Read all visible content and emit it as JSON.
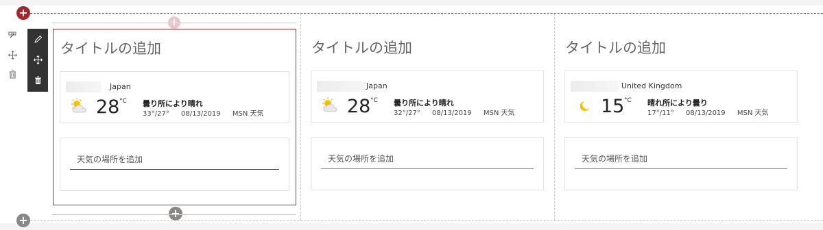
{
  "section": {
    "add_label": "+",
    "tools": {
      "edit_icon": "edit-section-icon",
      "move_icon": "move-icon",
      "delete_icon": "delete-icon"
    }
  },
  "toolbar": {
    "edit_icon": "pencil-icon",
    "move_icon": "move-icon",
    "delete_icon": "trash-icon"
  },
  "webparts": [
    {
      "title": "タイトルの追加",
      "country": "Japan",
      "temperature": "28",
      "unit": "°C",
      "condition": "曇り所により晴れ",
      "highlow": "33°/27°",
      "date": "08/13/2019",
      "source": "MSN 天気",
      "weather_icon": "partly-sunny-icon",
      "add_placeholder": "天気の場所を追加"
    },
    {
      "title": "タイトルの追加",
      "country": "Japan",
      "temperature": "28",
      "unit": "°C",
      "condition": "曇り所により晴れ",
      "highlow": "32°/27°",
      "date": "08/13/2019",
      "source": "MSN 天気",
      "weather_icon": "partly-sunny-icon",
      "add_placeholder": "天気の場所を追加"
    },
    {
      "title": "タイトルの追加",
      "country": "United Kingdom",
      "temperature": "15",
      "unit": "°C",
      "condition": "晴れ所により曇り",
      "highlow": "17°/11°",
      "date": "08/13/2019",
      "source": "MSN 天気",
      "weather_icon": "moon-icon",
      "add_placeholder": "天気の場所を追加"
    }
  ],
  "colors": {
    "accent": "#a4262c",
    "toolbar": "#333333"
  }
}
